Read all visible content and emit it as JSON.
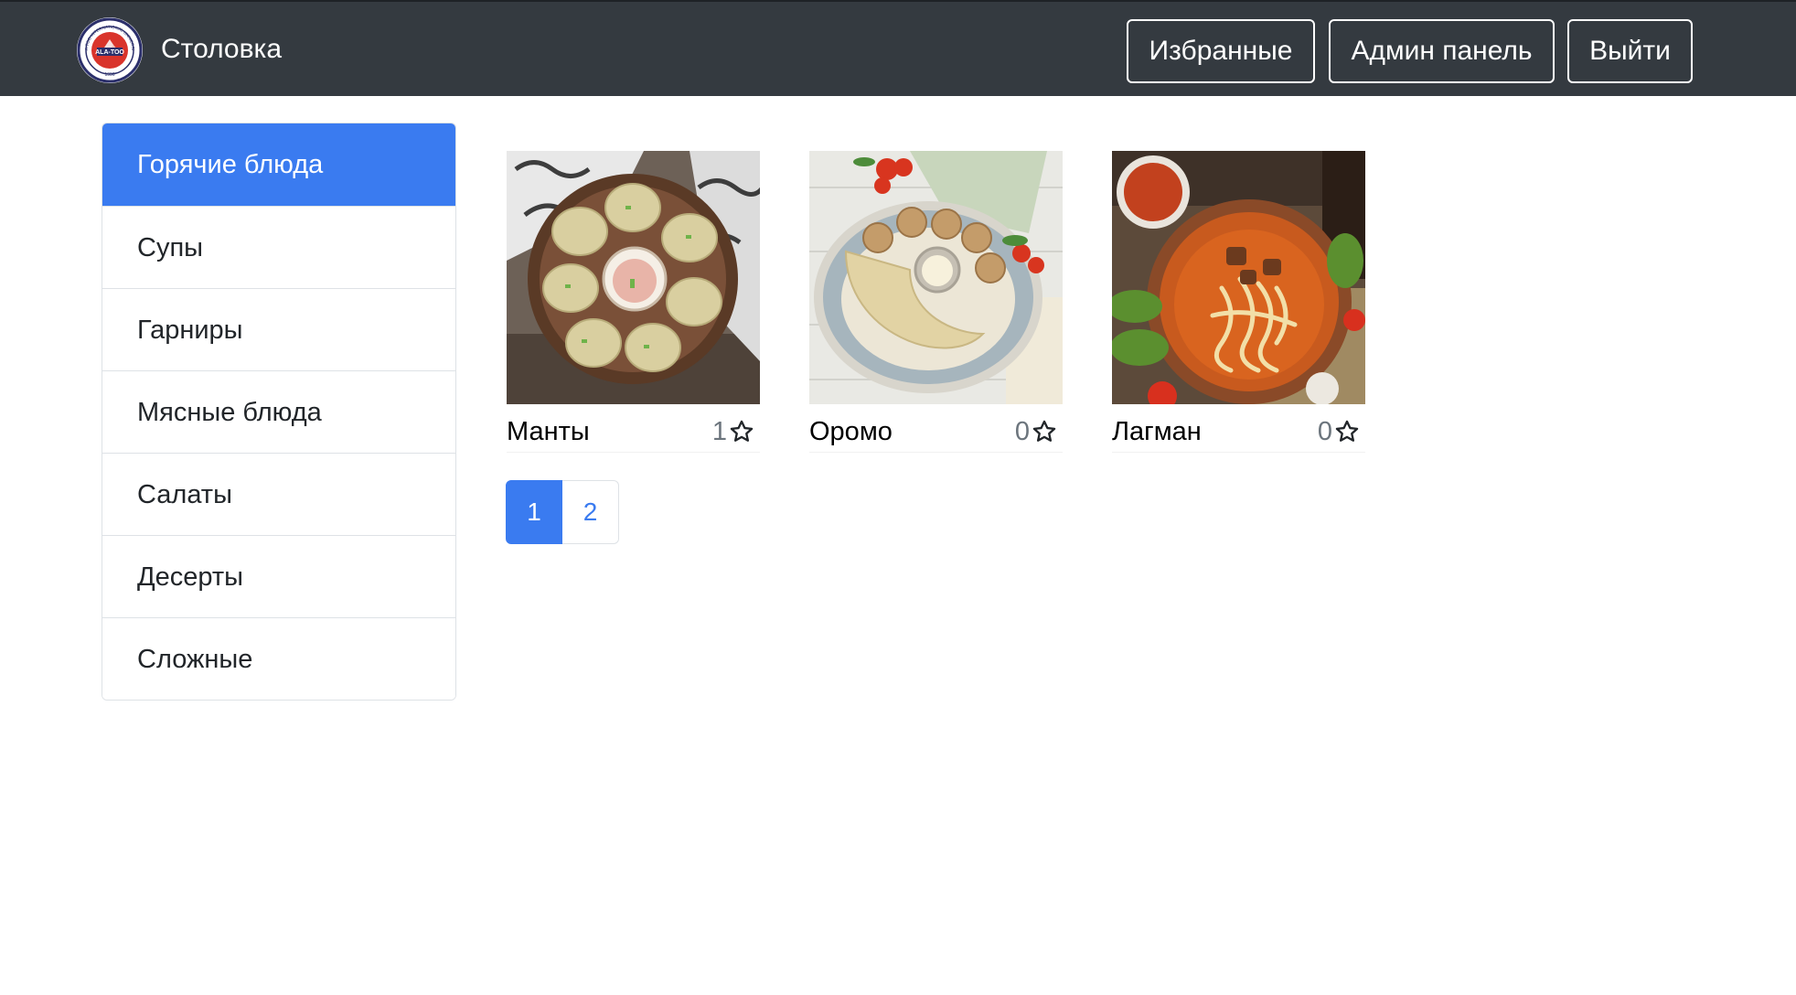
{
  "navbar": {
    "brand": "Столовка",
    "logo": {
      "top_text": "ALA-TOO INTERNATIONAL UNIVERSITY",
      "center_text": "ALA-TOO",
      "year": "1996"
    },
    "buttons": {
      "favorites": "Избранные",
      "admin": "Админ панель",
      "logout": "Выйти"
    }
  },
  "sidebar": {
    "active_index": 0,
    "items": [
      {
        "label": "Горячие блюда"
      },
      {
        "label": "Супы"
      },
      {
        "label": "Гарниры"
      },
      {
        "label": "Мясные блюда"
      },
      {
        "label": "Салаты"
      },
      {
        "label": "Десерты"
      },
      {
        "label": "Сложные"
      }
    ]
  },
  "dishes": [
    {
      "name": "Манты",
      "likes": "1",
      "icon": "star-outline-icon"
    },
    {
      "name": "Оромо",
      "likes": "0",
      "icon": "star-outline-icon"
    },
    {
      "name": "Лагман",
      "likes": "0",
      "icon": "star-outline-icon"
    }
  ],
  "pagination": {
    "pages": [
      "1",
      "2"
    ],
    "current": "1"
  },
  "colors": {
    "navbar_bg": "#343a40",
    "primary": "#3a7bf0",
    "border": "#dee2e6",
    "muted": "#6c757d"
  }
}
